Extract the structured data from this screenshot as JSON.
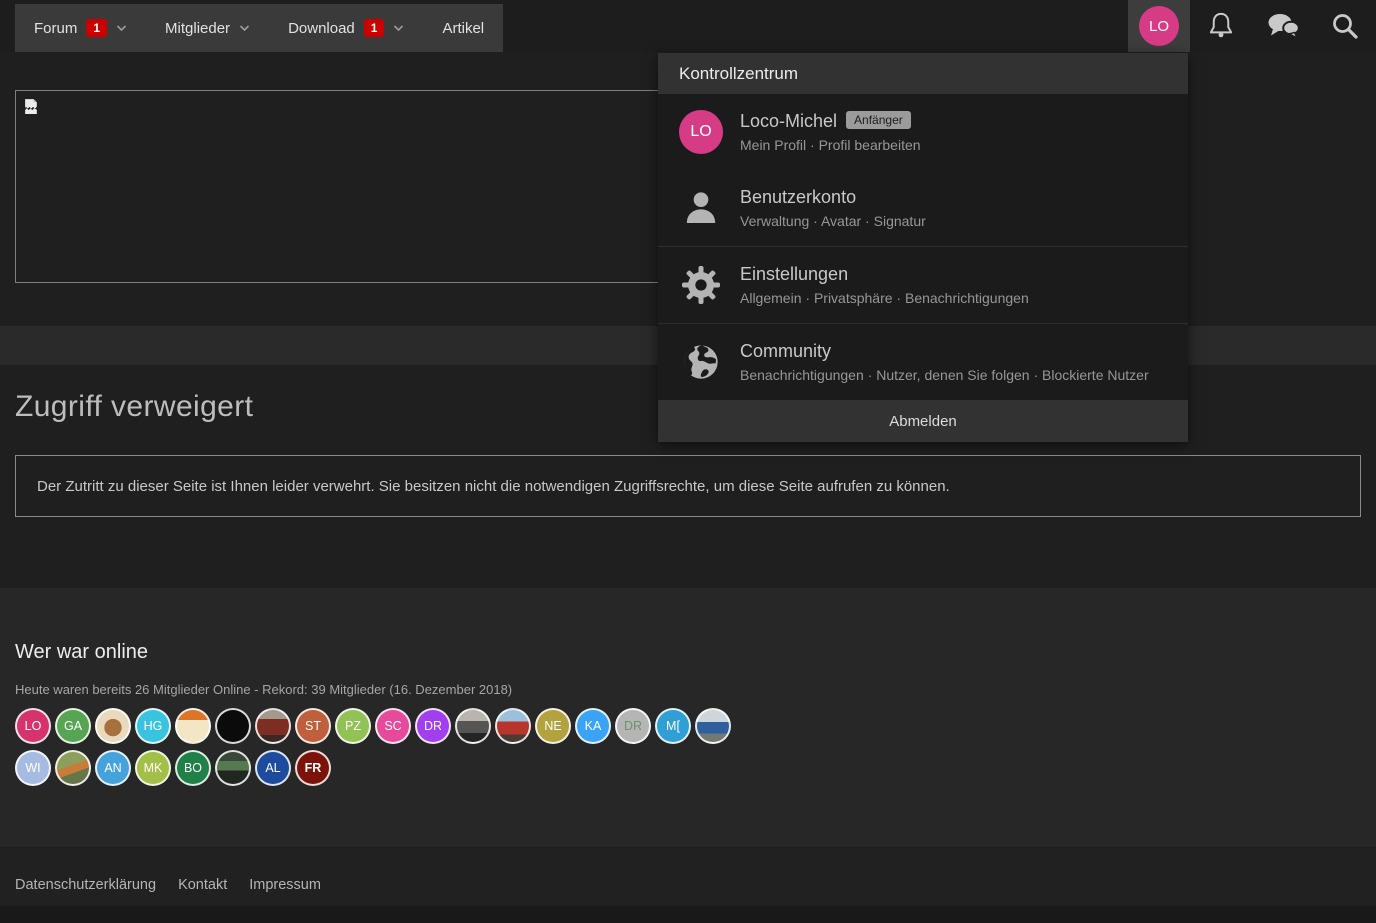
{
  "nav": {
    "menu_items": [
      {
        "label": "Forum",
        "badge": "1",
        "chevron": true
      },
      {
        "label": "Mitglieder",
        "badge": "",
        "chevron": true
      },
      {
        "label": "Download",
        "badge": "1",
        "chevron": true
      },
      {
        "label": "Artikel",
        "badge": "",
        "chevron": false
      }
    ],
    "user_initials": "LO"
  },
  "dropdown": {
    "title": "Kontrollzentrum",
    "user": {
      "initials": "LO",
      "name": "Loco-Michel",
      "rank_badge": "Anfänger",
      "links": [
        "Mein Profil",
        "Profil bearbeiten"
      ]
    },
    "sections": [
      {
        "icon": "user-silhouette-icon",
        "title": "Benutzerkonto",
        "links": [
          "Verwaltung",
          "Avatar",
          "Signatur"
        ]
      },
      {
        "icon": "gear-icon",
        "title": "Einstellungen",
        "links": [
          "Allgemein",
          "Privatsphäre",
          "Benachrichtigungen"
        ]
      },
      {
        "icon": "globe-icon",
        "title": "Community",
        "links": [
          "Benachrichtigungen",
          "Nutzer, denen Sie folgen",
          "Blockierte Nutzer"
        ]
      }
    ],
    "logout_label": "Abmelden"
  },
  "main": {
    "page_title": "Zugriff verweigert",
    "error_message": "Der Zutritt zu dieser Seite ist Ihnen leider verwehrt. Sie besitzen nicht die notwendigen Zugriffsrechte, um diese Seite aufrufen zu können."
  },
  "online": {
    "title": "Wer war online",
    "meta": "Heute waren bereits 26 Mitglieder Online - Rekord: 39 Mitglieder (16. Dezember 2018)",
    "rows": [
      [
        {
          "type": "initials",
          "text": "LO",
          "bg": "#d6336c"
        },
        {
          "type": "initials",
          "text": "GA",
          "bg": "#57a552"
        },
        {
          "type": "photo",
          "desc": "cartoon-figure-avatar",
          "bg": "radial-gradient(circle at 50% 55%, #a8703c 0 36%, #e9d9bd 37%)"
        },
        {
          "type": "initials",
          "text": "HG",
          "bg": "#38c4e0"
        },
        {
          "type": "photo",
          "desc": "orange-document-avatar",
          "bg": "linear-gradient(180deg,#de7426 0 32%,#f3e6c4 32%)"
        },
        {
          "type": "photo",
          "desc": "black-logo-avatar",
          "bg": "#0b0b0b"
        },
        {
          "type": "photo",
          "desc": "red-railcar-photo-avatar",
          "bg": "linear-gradient(180deg,#a29a8e 0 28%,#7d2d22 28% 78%,#3c2822 78%)"
        },
        {
          "type": "initials",
          "text": "ST",
          "bg": "#c05f3c"
        },
        {
          "type": "initials",
          "text": "PZ",
          "bg": "#92c156"
        },
        {
          "type": "initials",
          "text": "SC",
          "bg": "#e7499b"
        },
        {
          "type": "initials",
          "text": "DR",
          "bg": "#a13ef0"
        },
        {
          "type": "photo",
          "desc": "steam-locomotive-photo-avatar",
          "bg": "linear-gradient(180deg,#b9b4ac 0 34%,#555555 34% 72%,#242424 72%)"
        },
        {
          "type": "photo",
          "desc": "red-diesel-locomotive-photo-avatar",
          "bg": "linear-gradient(180deg,#9cc0dc 0 36%,#b8352c 36% 76%,#4a3c34 76%)"
        },
        {
          "type": "initials",
          "text": "NE",
          "bg": "#b2a33e"
        },
        {
          "type": "initials",
          "text": "KA",
          "bg": "#3aa3f5"
        },
        {
          "type": "initials",
          "text": "DR",
          "bg": "#b5b5b5",
          "fg": "#6f9468"
        },
        {
          "type": "initials",
          "text": "M[",
          "bg": "#2f9fd6"
        },
        {
          "type": "photo",
          "desc": "blue-locomotive-photo-avatar",
          "bg": "linear-gradient(180deg,#cdd6da 0 38%,#2f5f9e 38% 74%,#707a72 74%)"
        }
      ],
      [
        {
          "type": "initials",
          "text": "WI",
          "bg": "#a6bbe2"
        },
        {
          "type": "photo",
          "desc": "model-railway-diorama-avatar",
          "bg": "linear-gradient(160deg,#8aa05c 0 42%,#c77d3a 42% 62%,#66754a 62%)"
        },
        {
          "type": "initials",
          "text": "AN",
          "bg": "#46a2da"
        },
        {
          "type": "initials",
          "text": "MK",
          "bg": "#a2bf47"
        },
        {
          "type": "initials",
          "text": "BO",
          "bg": "#1f8048"
        },
        {
          "type": "photo",
          "desc": "green-bridge-photo-avatar",
          "bg": "linear-gradient(180deg,#39463a 0 28%,#557a50 28% 58%,#1f271e 58%)"
        },
        {
          "type": "initials",
          "text": "AL",
          "bg": "#1d4c9e"
        },
        {
          "type": "initials",
          "text": "FR",
          "bg": "#7c130b",
          "bold": true
        }
      ]
    ]
  },
  "footer": {
    "links": [
      "Datenschutzerklärung",
      "Kontakt",
      "Impressum"
    ]
  },
  "colors": {
    "accent_pink": "#d63c86",
    "badge_red": "#cc0000",
    "nav_menu_bg": "#3a3a3a",
    "panel_bg": "#1b1b1b",
    "panel_header_bg": "#323232"
  }
}
